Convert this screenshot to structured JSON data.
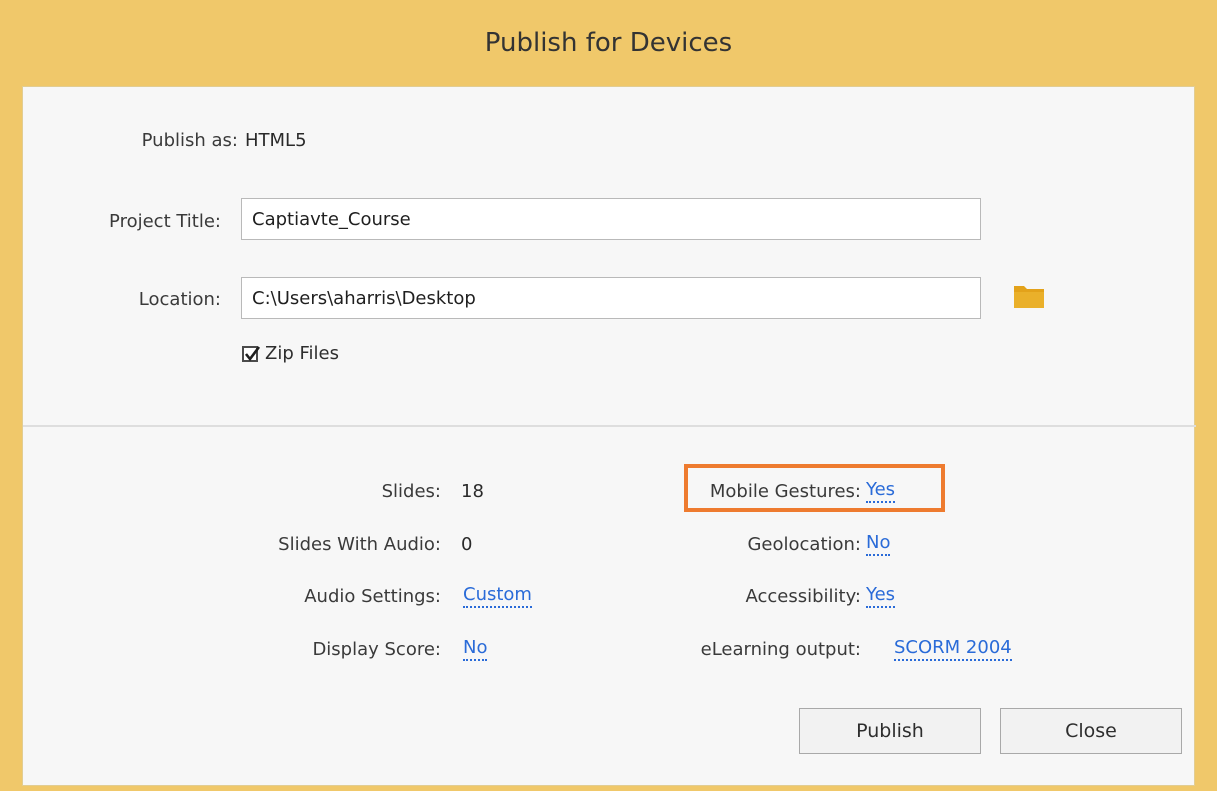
{
  "dialog": {
    "title": "Publish for Devices"
  },
  "form": {
    "publish_as_label": "Publish as:",
    "publish_as_value": "HTML5",
    "project_title_label": "Project Title:",
    "project_title_value": "Captiavte_Course",
    "location_label": "Location:",
    "location_value": "C:\\Users\\aharris\\Desktop",
    "zip_files_label": "Zip Files",
    "zip_files_checked": true
  },
  "summary": {
    "slides_label": "Slides:",
    "slides_value": "18",
    "slides_audio_label": "Slides With Audio:",
    "slides_audio_value": "0",
    "audio_settings_label": "Audio Settings:",
    "audio_settings_value": "Custom",
    "display_score_label": "Display Score:",
    "display_score_value": "No",
    "mobile_gestures_label": "Mobile Gestures:",
    "mobile_gestures_value": "Yes",
    "geolocation_label": "Geolocation:",
    "geolocation_value": "No",
    "accessibility_label": "Accessibility:",
    "accessibility_value": "Yes",
    "elearning_label": "eLearning output:",
    "elearning_value": "SCORM 2004"
  },
  "buttons": {
    "publish_label": "Publish",
    "close_label": "Close"
  },
  "icons": {
    "folder": "folder-icon",
    "checkbox": "checkmark-icon"
  },
  "colors": {
    "titlebar": "#f0c86a",
    "link": "#2a6bd8",
    "highlight": "#ee7b2f",
    "folder": "#e3a21a"
  }
}
